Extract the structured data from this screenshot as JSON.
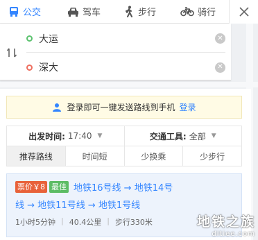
{
  "modes": [
    {
      "label": "公交",
      "icon": "bus-icon",
      "active": true
    },
    {
      "label": "驾车",
      "icon": "car-icon",
      "active": false
    },
    {
      "label": "步行",
      "icon": "walk-icon",
      "active": false
    },
    {
      "label": "骑行",
      "icon": "bike-icon",
      "active": false
    }
  ],
  "search": {
    "from": "大运",
    "to": "深大"
  },
  "login_tip": {
    "text": "登录即可一键发送路线到手机",
    "link": "登录"
  },
  "filters": {
    "depart_label": "出发时间:",
    "depart_value": "17:40",
    "transport_label": "交通工具:",
    "transport_value": "全部"
  },
  "tabs": [
    "推荐路线",
    "时间短",
    "少换乘",
    "少步行"
  ],
  "route": {
    "price_badge": "票价￥8",
    "best_badge": "最佳",
    "line1": "地铁16号线 → 地铁14号",
    "line2": "线 → 地铁11号线 → 地铁1号线",
    "duration": "1小时5分钟",
    "distance": "40.4公里",
    "walk": "步行330米"
  },
  "watermark": {
    "main": "地铁之族",
    "sub": "ditiee.com"
  },
  "colors": {
    "accent": "#3385ff",
    "price": "#e8623a",
    "best": "#5cbc64"
  }
}
